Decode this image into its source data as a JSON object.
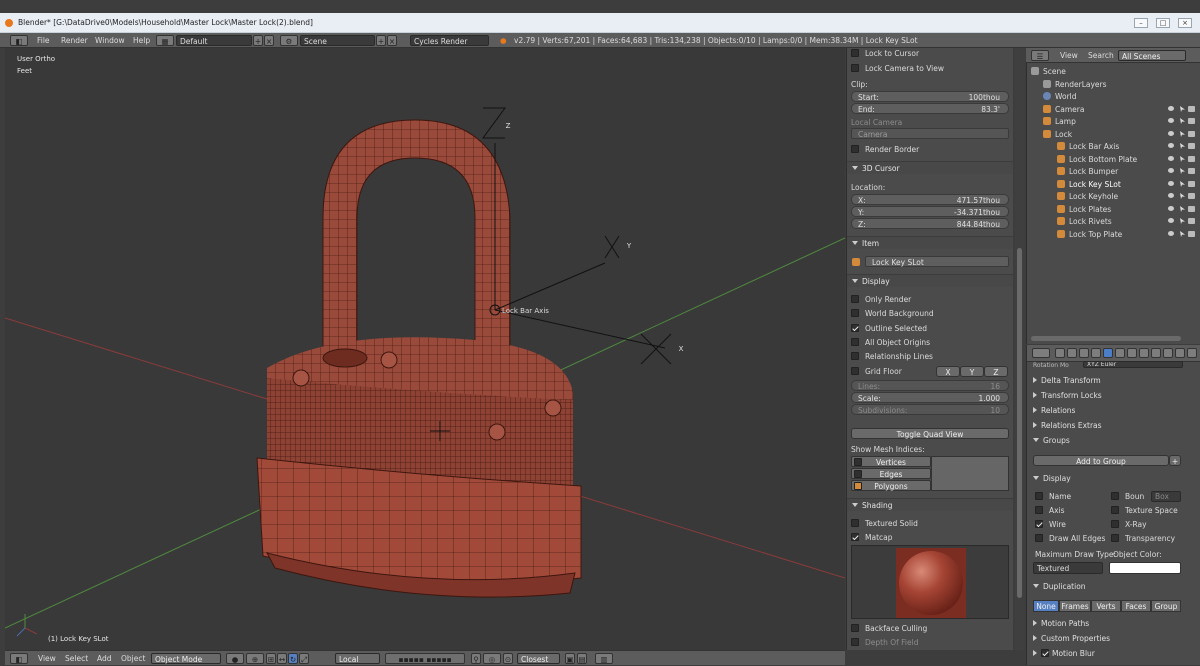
{
  "window": {
    "title": "Blender* [G:\\DataDrive0\\Models\\Household\\Master Lock\\Master Lock(2).blend]"
  },
  "topbar": {
    "menus": [
      "File",
      "Render",
      "Window",
      "Help"
    ],
    "layout": "Default",
    "scene": "Scene",
    "engine": "Cycles Render",
    "stats": "v2.79 | Verts:67,201 | Faces:64,683 | Tris:134,238 | Objects:0/10 | Lamps:0/0 | Mem:38.34M | Lock Key SLot"
  },
  "viewport": {
    "view_name": "User Ortho",
    "units": "Feet",
    "active_object": "(1) Lock Key SLot",
    "empty_label": "Lock Bar Axis",
    "axis_labels": {
      "x": "X",
      "y": "Y",
      "z": "Z"
    }
  },
  "viewport_header": {
    "menus": [
      "View",
      "Select",
      "Add",
      "Object"
    ],
    "mode": "Object Mode",
    "orientation": "Local",
    "snap": "Closest"
  },
  "props": {
    "lock_to_cursor": "Lock to Cursor",
    "lock_camera": "Lock Camera to View",
    "clip_label": "Clip:",
    "clip_start_label": "Start:",
    "clip_start": "100thou",
    "clip_end_label": "End:",
    "clip_end": "83.3'",
    "local_camera_label": "Local Camera",
    "camera_field": "Camera",
    "render_border": "Render Border",
    "cursor_section": "3D Cursor",
    "location_label": "Location:",
    "cursor_x_label": "X:",
    "cursor_x": "471.57thou",
    "cursor_y_label": "Y:",
    "cursor_y": "-34.371thou",
    "cursor_z_label": "Z:",
    "cursor_z": "844.84thou",
    "item_section": "Item",
    "item_name": "Lock Key SLot",
    "display_section": "Display",
    "only_render": "Only Render",
    "world_background": "World Background",
    "outline_selected": "Outline Selected",
    "all_object_origins": "All Object Origins",
    "relationship_lines": "Relationship Lines",
    "grid_floor": "Grid Floor",
    "grid_axes": [
      "X",
      "Y",
      "Z"
    ],
    "lines_label": "Lines:",
    "lines": "16",
    "scale_label": "Scale:",
    "scale": "1.000",
    "subdivisions_label": "Subdivisions:",
    "subdivisions": "10",
    "toggle_quad": "Toggle Quad View",
    "show_mesh_indices": "Show Mesh Indices:",
    "indices": [
      "Vertices",
      "Edges",
      "Polygons"
    ],
    "shading_section": "Shading",
    "textured_solid": "Textured Solid",
    "matcap": "Matcap",
    "backface_culling": "Backface Culling",
    "depth_of_field": "Depth Of Field"
  },
  "outliner": {
    "view_menu": "View",
    "search_menu": "Search",
    "filter": "All Scenes",
    "items": [
      {
        "label": "Scene",
        "color": "#9a9a9a"
      },
      {
        "label": "RenderLayers",
        "color": "#9a9a9a"
      },
      {
        "label": "World",
        "color": "#6b86b5"
      },
      {
        "label": "Camera",
        "color": "#d38a3a"
      },
      {
        "label": "Lamp",
        "color": "#d38a3a"
      },
      {
        "label": "Lock",
        "color": "#d38a3a"
      },
      {
        "label": "Lock Bar Axis",
        "color": "#d38a3a"
      },
      {
        "label": "Lock Bottom Plate",
        "color": "#d38a3a"
      },
      {
        "label": "Lock Bumper",
        "color": "#d38a3a"
      },
      {
        "label": "Lock Key SLot",
        "color": "#d38a3a"
      },
      {
        "label": "Lock Keyhole",
        "color": "#d38a3a"
      },
      {
        "label": "Lock Plates",
        "color": "#d38a3a"
      },
      {
        "label": "Lock Rivets",
        "color": "#d38a3a"
      },
      {
        "label": "Lock Top Plate",
        "color": "#d38a3a"
      }
    ]
  },
  "objprops": {
    "rotation_label": "Rotation Mo",
    "rotation_value": "XYZ Euler",
    "delta_transform": "Delta Transform",
    "transform_locks": "Transform Locks",
    "relations": "Relations",
    "relations_extras": "Relations Extras",
    "groups": "Groups",
    "add_to_group": "Add to Group",
    "display": "Display",
    "name": "Name",
    "bounds": "Boun",
    "bounds_value": "Box",
    "axis": "Axis",
    "texture_space": "Texture Space",
    "wire": "Wire",
    "xray": "X-Ray",
    "draw_all_edges": "Draw All Edges",
    "transparency": "Transparency",
    "max_draw_type_label": "Maximum Draw Type:",
    "max_draw_type": "Textured",
    "object_color_label": "Object Color:",
    "duplication": "Duplication",
    "dup_options": [
      "None",
      "Frames",
      "Verts",
      "Faces",
      "Group"
    ],
    "motion_paths": "Motion Paths",
    "custom_properties": "Custom Properties",
    "motion_blur": "Motion Blur"
  }
}
